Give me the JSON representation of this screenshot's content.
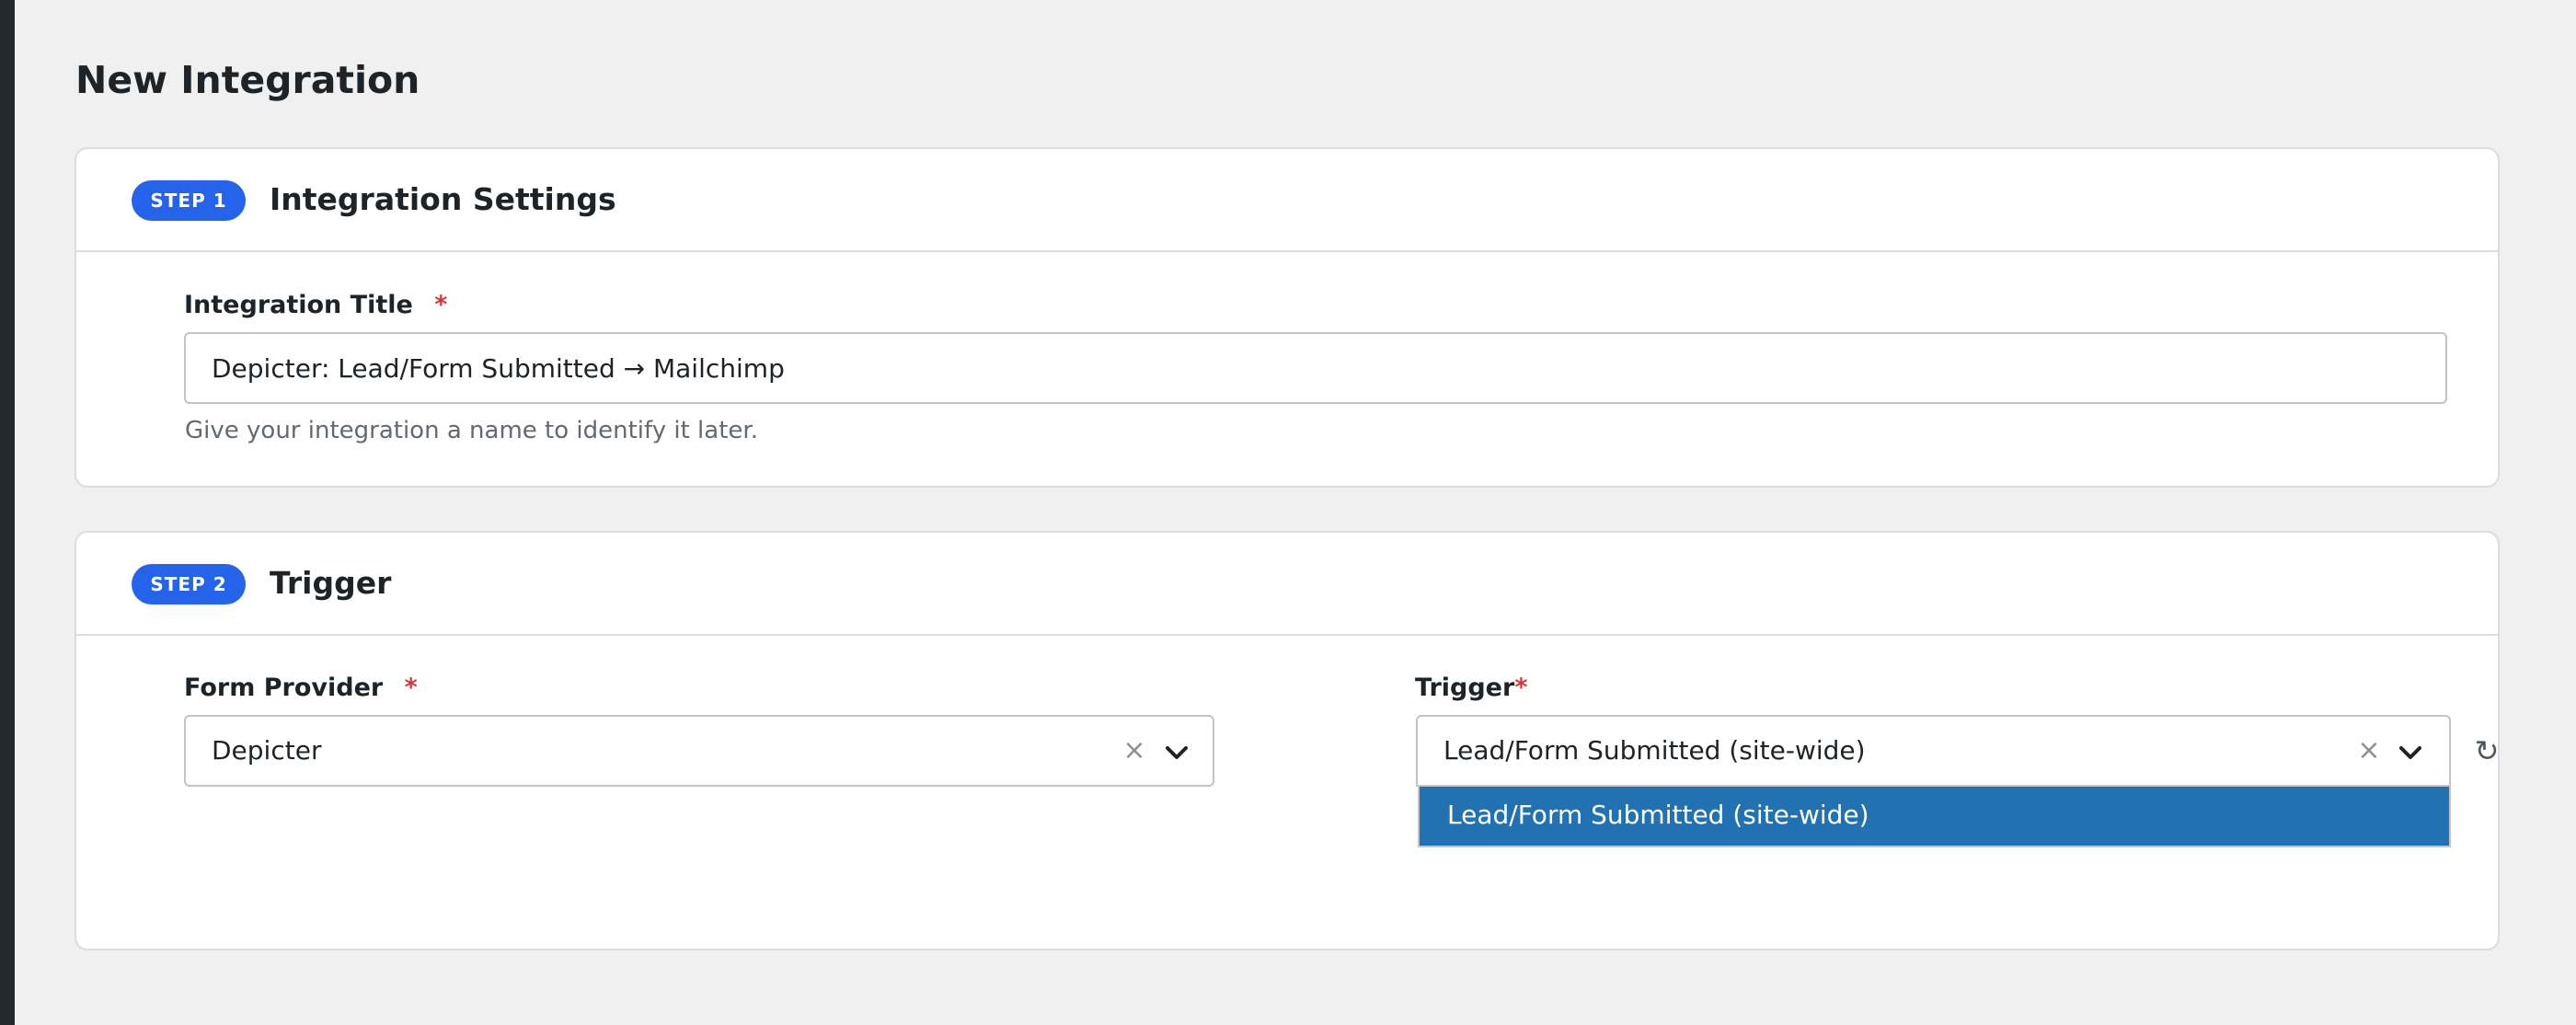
{
  "page": {
    "title": "New Integration"
  },
  "step1": {
    "badge": "STEP 1",
    "title": "Integration Settings",
    "integration_title": {
      "label": "Integration Title",
      "required_mark": "*",
      "value": "Depicter: Lead/Form Submitted → Mailchimp",
      "help": "Give your integration a name to identify it later."
    }
  },
  "step2": {
    "badge": "STEP 2",
    "title": "Trigger",
    "form_provider": {
      "label": "Form Provider",
      "required_mark": "*",
      "value": "Depicter",
      "clear_glyph": "×"
    },
    "trigger": {
      "label": "Trigger",
      "required_mark": "*",
      "value": "Lead/Form Submitted (site-wide)",
      "clear_glyph": "×",
      "refresh_glyph": "↻",
      "options": [
        "Lead/Form Submitted (site-wide)"
      ],
      "highlighted_option_color": "#2271b1"
    }
  },
  "icons": {
    "chevron": "chevron-down-icon",
    "clear": "clear-icon",
    "refresh": "refresh-icon"
  },
  "colors": {
    "accent": "#2563eb",
    "required": "#d63638",
    "selection": "#2271b1",
    "background": "#f0f0f1"
  }
}
